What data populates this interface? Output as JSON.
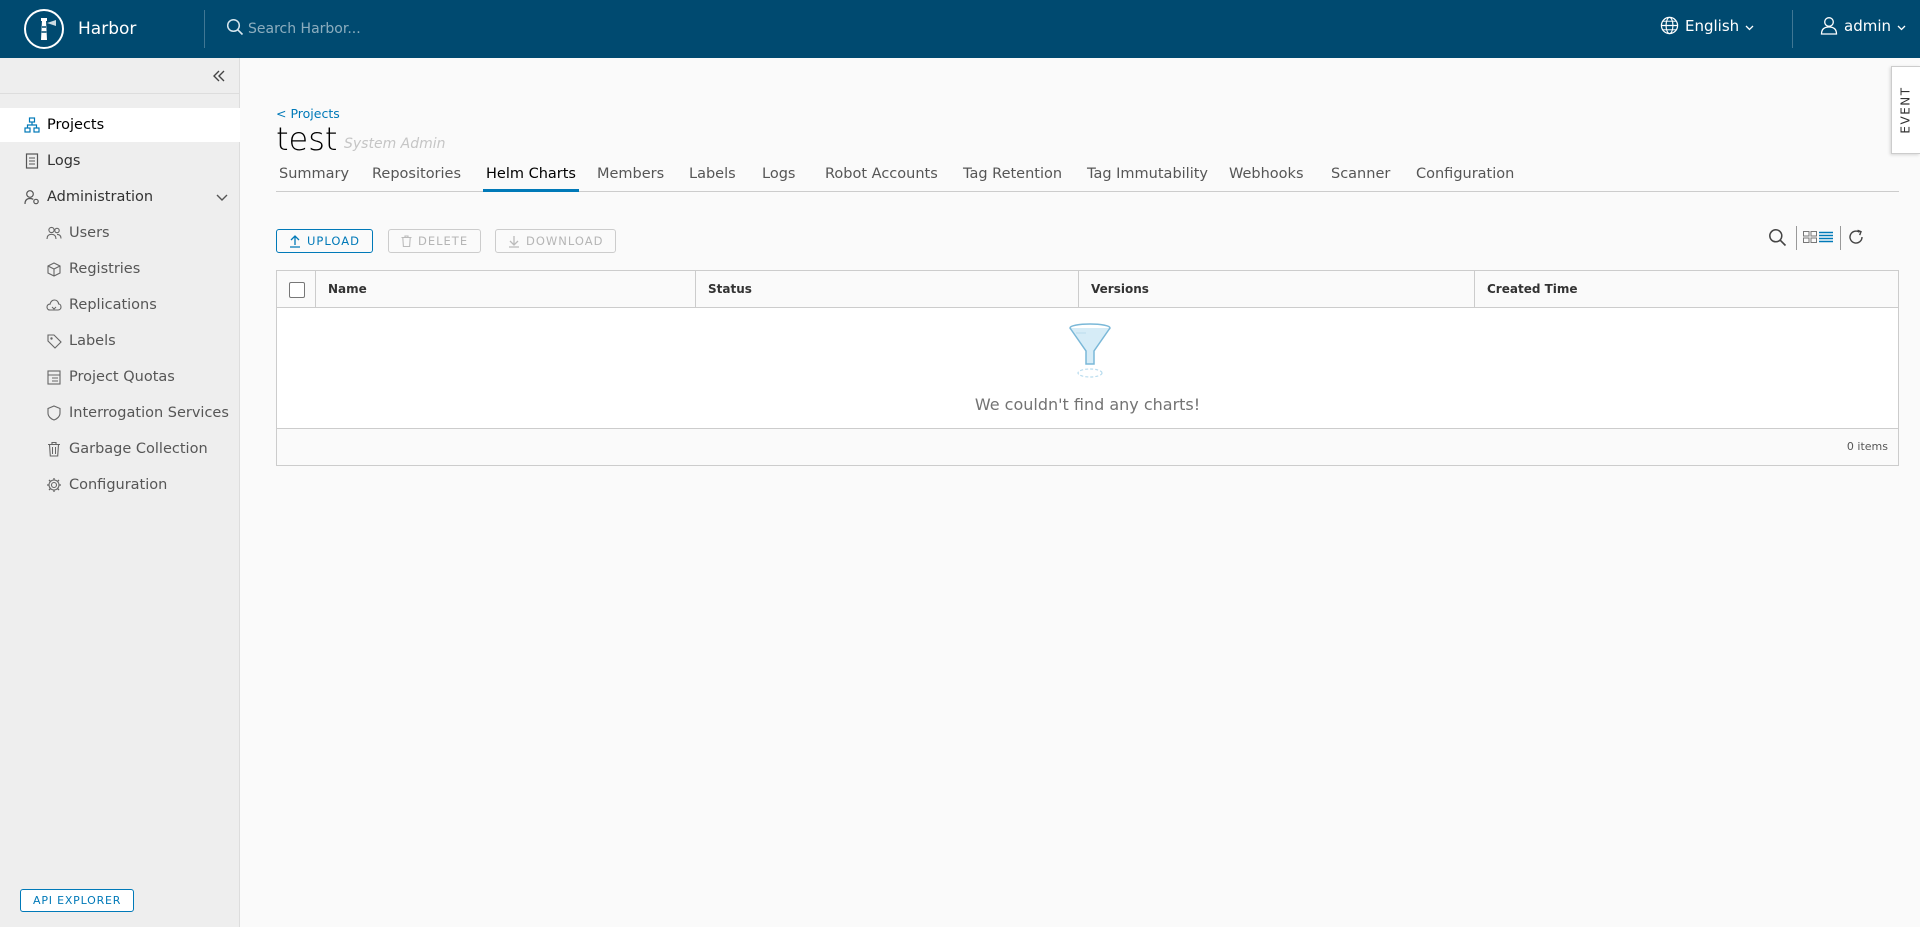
{
  "header": {
    "brand": "Harbor",
    "search_placeholder": "Search Harbor...",
    "language": "English",
    "user": "admin"
  },
  "sidebar": {
    "items": [
      {
        "label": "Projects",
        "icon": "projects-icon"
      },
      {
        "label": "Logs",
        "icon": "logs-icon"
      },
      {
        "label": "Administration",
        "icon": "administration-icon"
      }
    ],
    "admin_items": [
      {
        "label": "Users",
        "icon": "users-icon"
      },
      {
        "label": "Registries",
        "icon": "registries-icon"
      },
      {
        "label": "Replications",
        "icon": "replications-icon"
      },
      {
        "label": "Labels",
        "icon": "tag-icon"
      },
      {
        "label": "Project Quotas",
        "icon": "quotas-icon"
      },
      {
        "label": "Interrogation Services",
        "icon": "shield-icon"
      },
      {
        "label": "Garbage Collection",
        "icon": "trash-icon"
      },
      {
        "label": "Configuration",
        "icon": "gear-icon"
      }
    ],
    "api_explorer": "API EXPLORER"
  },
  "page": {
    "breadcrumb": "< Projects",
    "title": "test",
    "role": "System Admin",
    "tabs": [
      "Summary",
      "Repositories",
      "Helm Charts",
      "Members",
      "Labels",
      "Logs",
      "Robot Accounts",
      "Tag Retention",
      "Tag Immutability",
      "Webhooks",
      "Scanner",
      "Configuration"
    ],
    "active_tab": "Helm Charts"
  },
  "toolbar": {
    "upload": "UPLOAD",
    "delete": "DELETE",
    "download": "DOWNLOAD"
  },
  "grid": {
    "columns": [
      "Name",
      "Status",
      "Versions",
      "Created Time"
    ],
    "empty_message": "We couldn't find any charts!",
    "item_count": "0 items"
  },
  "event_panel": "EVENT",
  "colors": {
    "header": "#004a70",
    "accent": "#0079b8"
  }
}
